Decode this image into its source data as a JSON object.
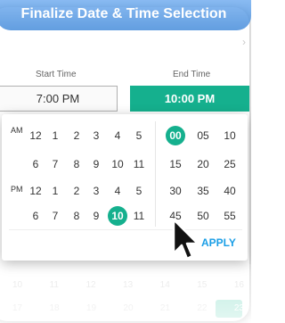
{
  "modal": {
    "title": "Finalize Date & Time Selection",
    "close_glyph": "›",
    "start_label": "Start Time",
    "end_label": "End Time",
    "start_value": "7:00 PM",
    "end_value": "10:00 PM"
  },
  "picker": {
    "am_label": "AM",
    "pm_label": "PM",
    "am_row1": [
      "12",
      "1",
      "2",
      "3",
      "4",
      "5"
    ],
    "am_row2": [
      "6",
      "7",
      "8",
      "9",
      "10",
      "11"
    ],
    "pm_row1": [
      "12",
      "1",
      "2",
      "3",
      "4",
      "5"
    ],
    "pm_row2": [
      "6",
      "7",
      "8",
      "9",
      "10",
      "11"
    ],
    "selected_hour": "10 PM",
    "minutes": [
      "00",
      "05",
      "10",
      "15",
      "20",
      "25",
      "30",
      "35",
      "40",
      "45",
      "50",
      "55"
    ],
    "selected_minute": "00",
    "apply_label": "APPLY"
  },
  "background_calendar": {
    "row1": [
      "10",
      "11",
      "12",
      "13",
      "14",
      "15",
      "16"
    ],
    "row2": [
      "17",
      "18",
      "19",
      "20",
      "21",
      "22",
      "23"
    ]
  },
  "colors": {
    "accent": "#15b08e",
    "header": "#2f7ed6",
    "apply": "#1a9ee6"
  },
  "icons": {
    "cursor": "arrow-pointer-icon",
    "close": "chevron-right-icon"
  }
}
